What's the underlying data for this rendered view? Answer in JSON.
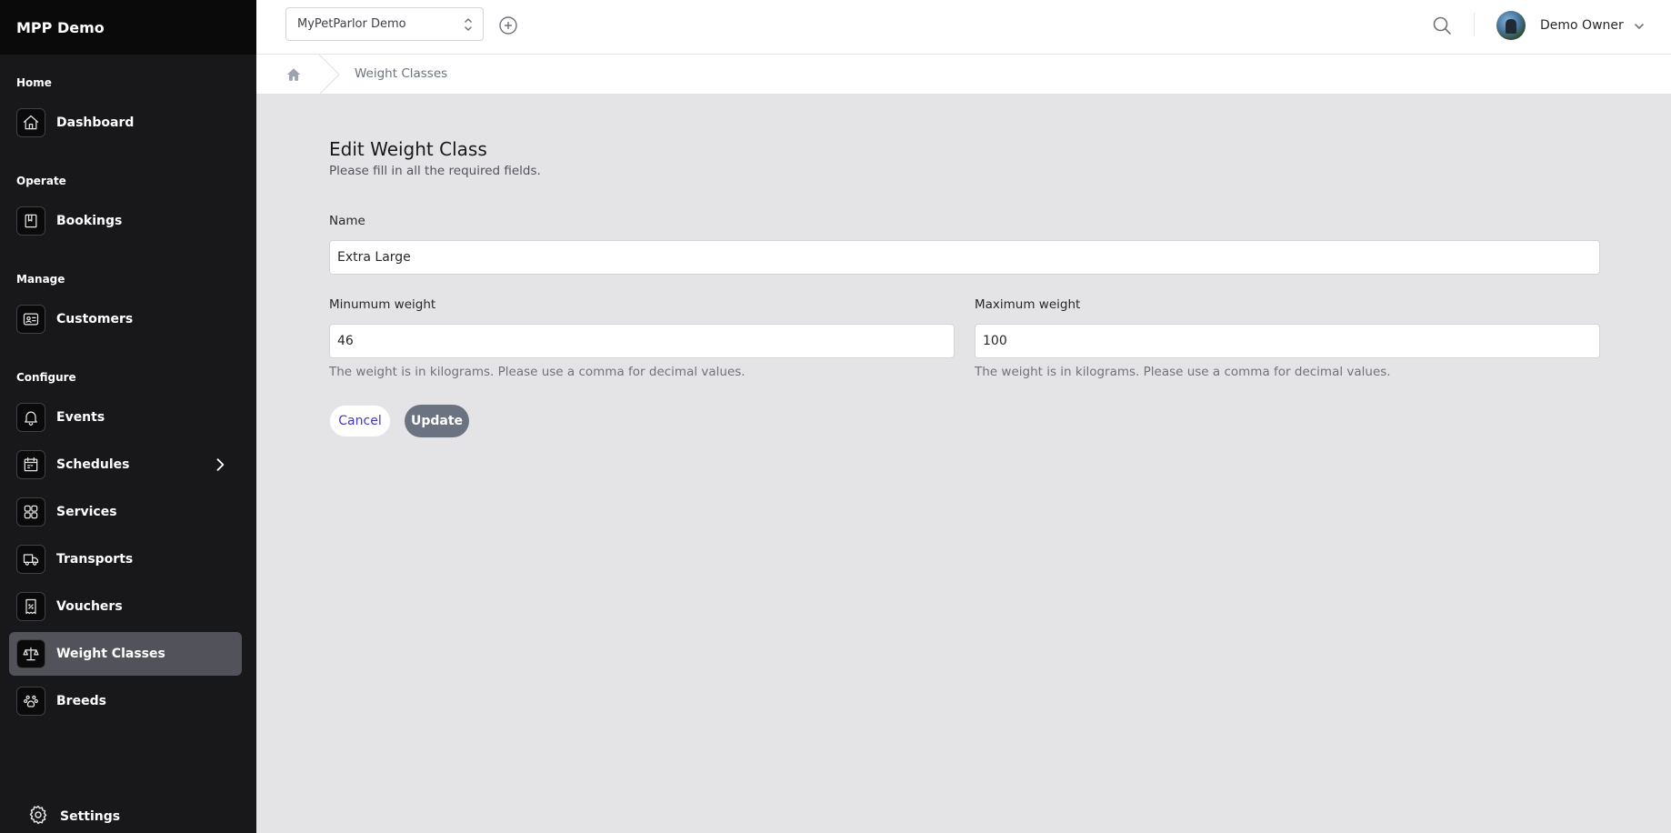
{
  "app": {
    "brand": "MPP Demo"
  },
  "topbar": {
    "org_selected": "MyPetParlor Demo",
    "user_name": "Demo Owner"
  },
  "breadcrumb": {
    "current": "Weight Classes"
  },
  "sidebar": {
    "sections": [
      {
        "title": "Home"
      },
      {
        "title": "Operate"
      },
      {
        "title": "Manage"
      },
      {
        "title": "Configure"
      }
    ],
    "items": [
      {
        "label": "Dashboard",
        "icon": "home-icon"
      },
      {
        "label": "Bookings",
        "icon": "book-icon"
      },
      {
        "label": "Customers",
        "icon": "id-card-icon"
      },
      {
        "label": "Events",
        "icon": "bell-icon"
      },
      {
        "label": "Schedules",
        "icon": "calendar-icon"
      },
      {
        "label": "Services",
        "icon": "grid-icon"
      },
      {
        "label": "Transports",
        "icon": "truck-icon"
      },
      {
        "label": "Vouchers",
        "icon": "voucher-icon"
      },
      {
        "label": "Weight Classes",
        "icon": "scale-icon",
        "active": true
      },
      {
        "label": "Breeds",
        "icon": "paw-icon"
      }
    ],
    "settings_label": "Settings"
  },
  "form": {
    "title": "Edit Weight Class",
    "subtitle": "Please fill in all the required fields.",
    "name_label": "Name",
    "name_value": "Extra Large",
    "min_label": "Minumum weight",
    "min_value": "46",
    "min_hint": "The weight is in kilograms. Please use a comma for decimal values.",
    "max_label": "Maximum weight",
    "max_value": "100",
    "max_hint": "The weight is in kilograms. Please use a comma for decimal values.",
    "cancel_label": "Cancel",
    "update_label": "Update"
  },
  "colors": {
    "sidebar_bg": "#18181b",
    "active_item_bg": "#52525b",
    "content_bg": "#e4e4e7",
    "cancel_text": "#4338ca",
    "update_bg": "#6b7280"
  }
}
